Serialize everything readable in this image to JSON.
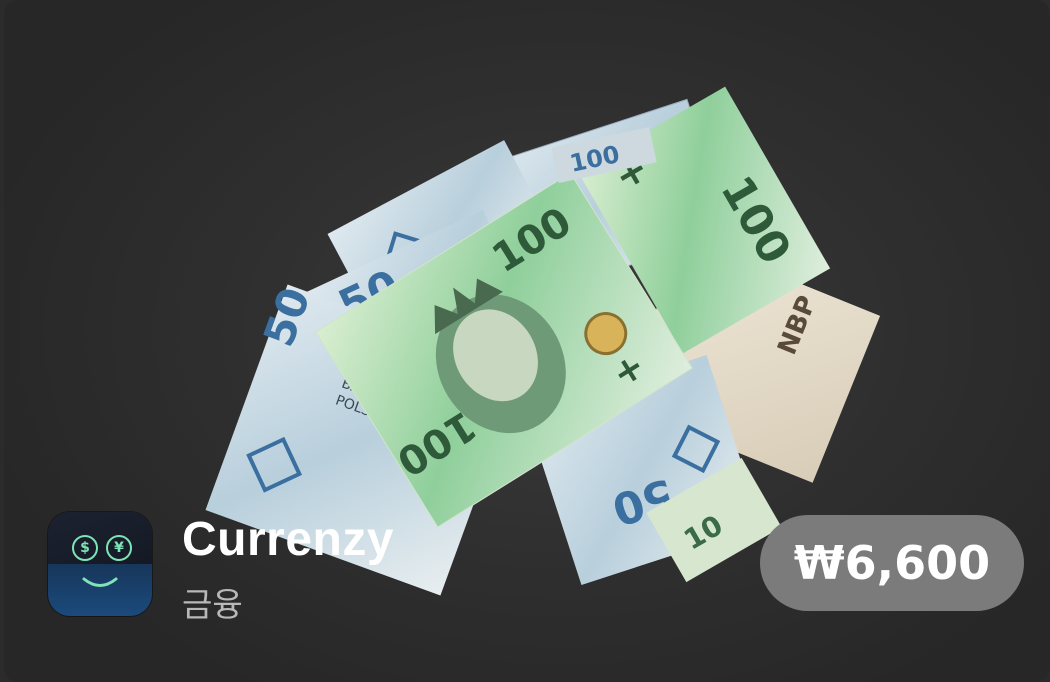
{
  "app": {
    "name": "Currenzy",
    "category": "금융",
    "price": "₩6,600",
    "icon": "currenzy-face-icon"
  },
  "hero": {
    "icon": "banknotes-pile-image",
    "notes": [
      {
        "denomination": "100"
      },
      {
        "denomination": "50"
      },
      {
        "denomination": "100"
      },
      {
        "denomination": "50"
      },
      {
        "denomination": "100"
      },
      {
        "denomination": "50"
      },
      {
        "denomination": "10"
      }
    ]
  },
  "colors": {
    "background": "#2b2b2b",
    "price_button": "#7b7b7b",
    "note_green": "#9fd6a8",
    "note_blue": "#a9c7dd"
  }
}
